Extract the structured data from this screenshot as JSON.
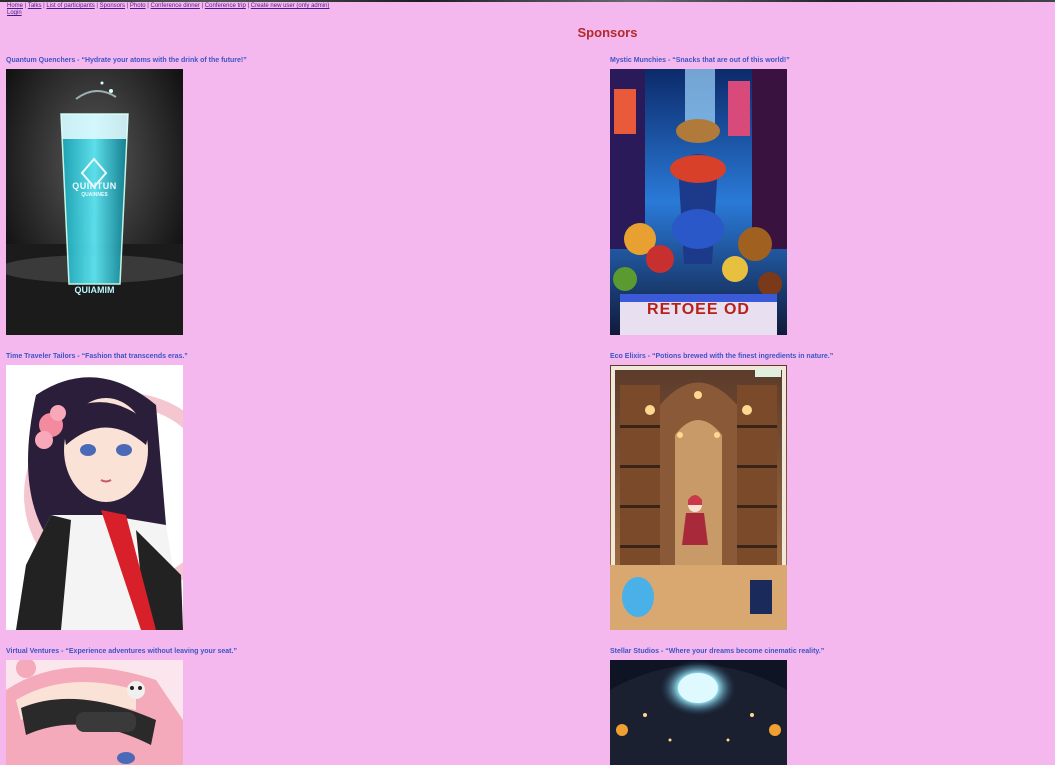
{
  "nav": {
    "links": [
      "Home",
      "Talks",
      "List of participants",
      "Sponsors",
      "Photo",
      "Conference dinner",
      "Conference trip",
      "Create new user (only admin)"
    ],
    "login": "Login",
    "separator": "|"
  },
  "page_title": "Sponsors",
  "sponsors": [
    {
      "name": "Quantum Quenchers",
      "tagline": "“Hydrate your atoms with the drink of the future!”",
      "caption": "Quantum Quenchers - “Hydrate your atoms with the drink of the future!”",
      "poster_text_top": "QUINTUN",
      "poster_text_mid": "QUAINNES",
      "poster_text_bottom": "QUIAMIM"
    },
    {
      "name": "Mystic Munchies",
      "tagline": "“Snacks that are out of this world!”",
      "caption": "Mystic Munchies - “Snacks that are out of this world!”",
      "poster_text": "RETOEE OD"
    },
    {
      "name": "Time Traveler Tailors",
      "tagline": "“Fashion that transcends eras.”",
      "caption": "Time Traveler Tailors - “Fashion that transcends eras.”"
    },
    {
      "name": "Eco Elixirs",
      "tagline": "“Potions brewed with the finest ingredients in nature.”",
      "caption": "Eco Elixirs - “Potions brewed with the finest ingredients in nature.”"
    },
    {
      "name": "Virtual Ventures",
      "tagline": "“Experience adventures without leaving your seat.”",
      "caption": "Virtual Ventures - “Experience adventures without leaving your seat.”"
    },
    {
      "name": "Stellar Studios",
      "tagline": "“Where your dreams become cinematic reality.”",
      "caption": "Stellar Studios - “Where your dreams become cinematic reality.”"
    }
  ],
  "colors": {
    "background": "#f5b8ee",
    "title": "#b22a2a",
    "caption": "#3b55c6",
    "nav_link": "#4a1a8a"
  }
}
